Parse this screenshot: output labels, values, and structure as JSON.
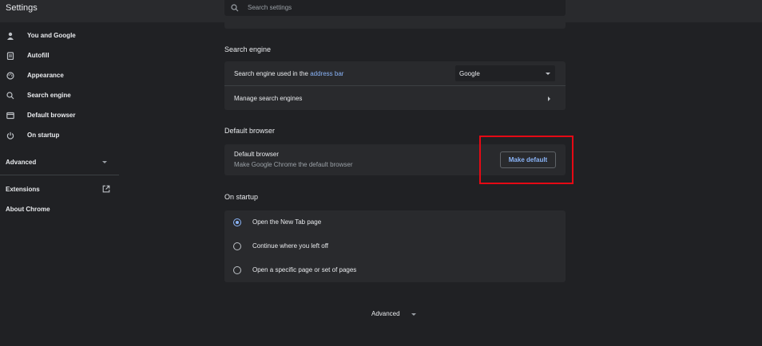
{
  "header": {
    "title": "Settings",
    "search_placeholder": "Search settings"
  },
  "sidebar": {
    "items": [
      {
        "label": "You and Google",
        "icon": "person-icon"
      },
      {
        "label": "Autofill",
        "icon": "clipboard-icon"
      },
      {
        "label": "Appearance",
        "icon": "palette-icon"
      },
      {
        "label": "Search engine",
        "icon": "search-icon"
      },
      {
        "label": "Default browser",
        "icon": "browser-window-icon"
      },
      {
        "label": "On startup",
        "icon": "power-icon"
      }
    ],
    "advanced_label": "Advanced",
    "extensions_label": "Extensions",
    "about_label": "About Chrome"
  },
  "search_engine": {
    "section_title": "Search engine",
    "used_in_prefix": "Search engine used in the ",
    "used_in_link": "address bar",
    "selected_engine": "Google",
    "manage_label": "Manage search engines"
  },
  "default_browser": {
    "section_title": "Default browser",
    "row_title": "Default browser",
    "row_subtitle": "Make Google Chrome the default browser",
    "button_label": "Make default"
  },
  "on_startup": {
    "section_title": "On startup",
    "options": [
      {
        "label": "Open the New Tab page",
        "selected": true
      },
      {
        "label": "Continue where you left off",
        "selected": false
      },
      {
        "label": "Open a specific page or set of pages",
        "selected": false
      }
    ]
  },
  "footer": {
    "advanced_label": "Advanced"
  },
  "colors": {
    "background": "#202124",
    "card": "#292a2d",
    "accent": "#8ab4f8",
    "highlight_box": "#e50914"
  }
}
